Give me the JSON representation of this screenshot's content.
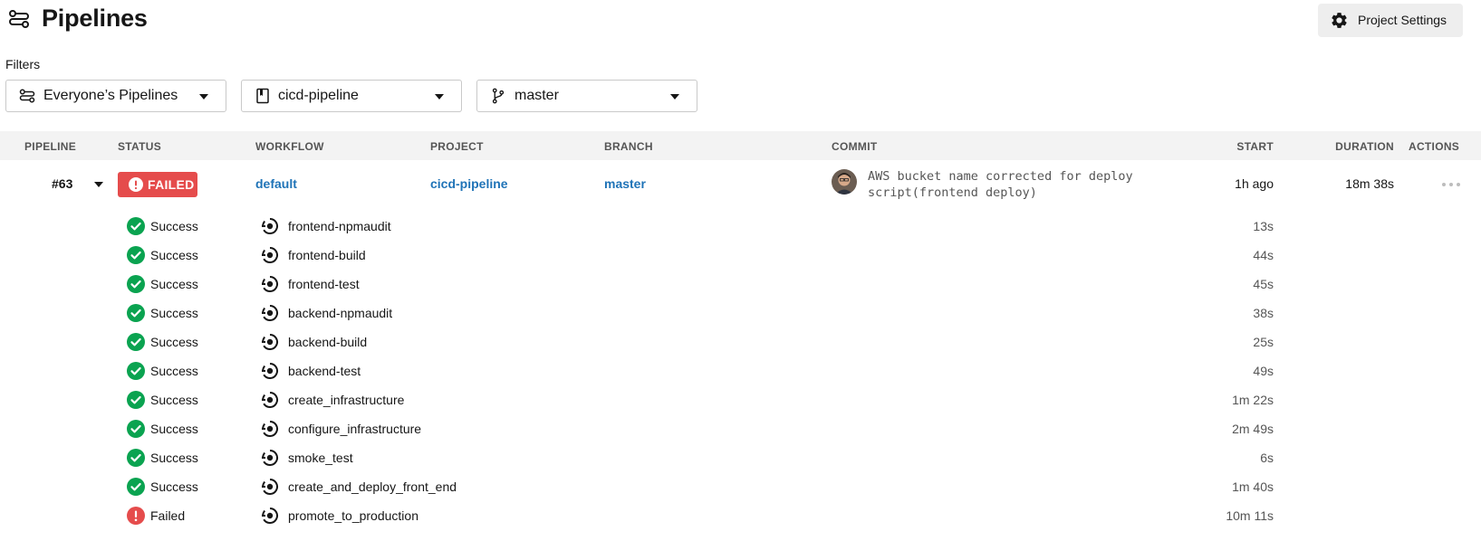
{
  "header": {
    "title": "Pipelines",
    "title_icon": "pipelines-icon",
    "settings_button": {
      "label": "Project Settings",
      "icon": "gear-icon"
    }
  },
  "filters": {
    "label": "Filters",
    "pipelines": {
      "value": "Everyone’s Pipelines",
      "icon": "pipelines-icon"
    },
    "project": {
      "value": "cicd-pipeline",
      "icon": "repo-icon"
    },
    "branch": {
      "value": "master",
      "icon": "branch-icon"
    }
  },
  "table": {
    "columns": {
      "pipeline": "PIPELINE",
      "status": "STATUS",
      "workflow": "WORKFLOW",
      "project": "PROJECT",
      "branch": "BRANCH",
      "commit": "COMMIT",
      "start": "START",
      "duration": "DURATION",
      "actions": "ACTIONS"
    },
    "pipeline": {
      "number": "#63",
      "status": "FAILED",
      "workflow": "default",
      "project": "cicd-pipeline",
      "branch": "master",
      "commit_message": "AWS bucket name corrected for deploy script(frontend deploy)",
      "start": "1h ago",
      "duration": "18m 38s"
    },
    "jobs": [
      {
        "status": "Success",
        "name": "frontend-npmaudit",
        "duration": "13s"
      },
      {
        "status": "Success",
        "name": "frontend-build",
        "duration": "44s"
      },
      {
        "status": "Success",
        "name": "frontend-test",
        "duration": "45s"
      },
      {
        "status": "Success",
        "name": "backend-npmaudit",
        "duration": "38s"
      },
      {
        "status": "Success",
        "name": "backend-build",
        "duration": "25s"
      },
      {
        "status": "Success",
        "name": "backend-test",
        "duration": "49s"
      },
      {
        "status": "Success",
        "name": "create_infrastructure",
        "duration": "1m 22s"
      },
      {
        "status": "Success",
        "name": "configure_infrastructure",
        "duration": "2m 49s"
      },
      {
        "status": "Success",
        "name": "smoke_test",
        "duration": "6s"
      },
      {
        "status": "Success",
        "name": "create_and_deploy_front_end",
        "duration": "1m 40s"
      },
      {
        "status": "Failed",
        "name": "promote_to_production",
        "duration": "10m 11s"
      }
    ]
  },
  "colors": {
    "success": "#0aa350",
    "failed": "#e54c4c",
    "link": "#1f73b7",
    "header_bg": "#f3f3f3"
  }
}
